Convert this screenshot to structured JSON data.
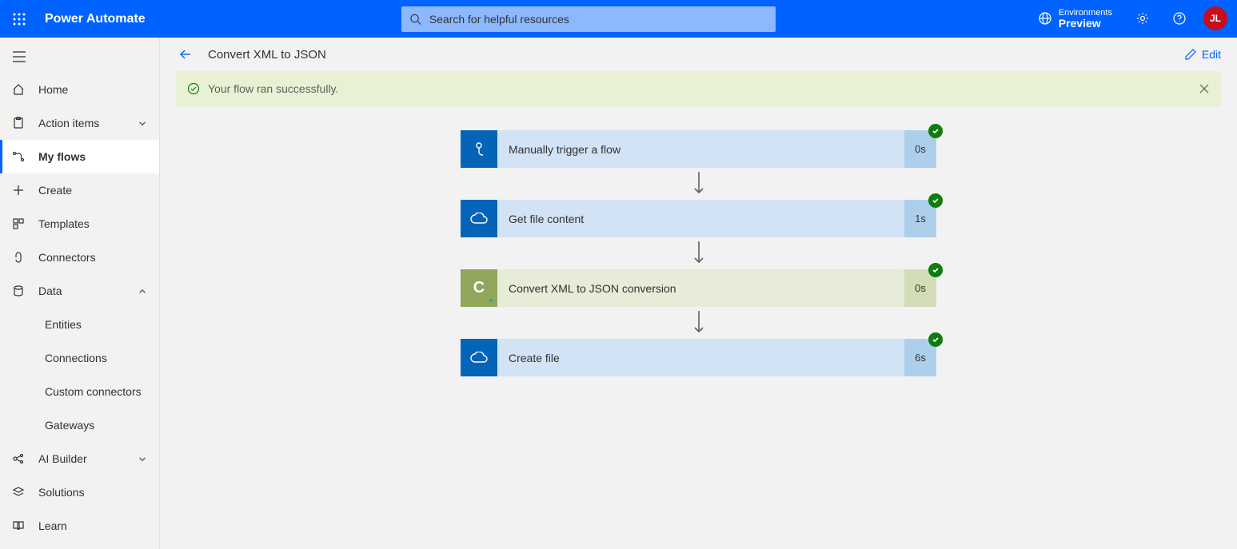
{
  "header": {
    "app_title": "Power Automate",
    "search_placeholder": "Search for helpful resources",
    "environments_label": "Environments",
    "environments_value": "Preview",
    "avatar_initials": "JL"
  },
  "sidebar": {
    "items": [
      {
        "label": "Home"
      },
      {
        "label": "Action items"
      },
      {
        "label": "My flows"
      },
      {
        "label": "Create"
      },
      {
        "label": "Templates"
      },
      {
        "label": "Connectors"
      },
      {
        "label": "Data"
      },
      {
        "label": "AI Builder"
      },
      {
        "label": "Solutions"
      },
      {
        "label": "Learn"
      }
    ],
    "data_children": [
      {
        "label": "Entities"
      },
      {
        "label": "Connections"
      },
      {
        "label": "Custom connectors"
      },
      {
        "label": "Gateways"
      }
    ]
  },
  "crumb": {
    "title": "Convert XML to JSON",
    "edit_label": "Edit"
  },
  "notice": {
    "text": "Your flow ran successfully."
  },
  "flow": {
    "steps": [
      {
        "title": "Manually trigger a flow",
        "duration": "0s"
      },
      {
        "title": "Get file content",
        "duration": "1s"
      },
      {
        "title": "Convert XML to JSON conversion",
        "duration": "0s"
      },
      {
        "title": "Create file",
        "duration": "6s"
      }
    ]
  }
}
